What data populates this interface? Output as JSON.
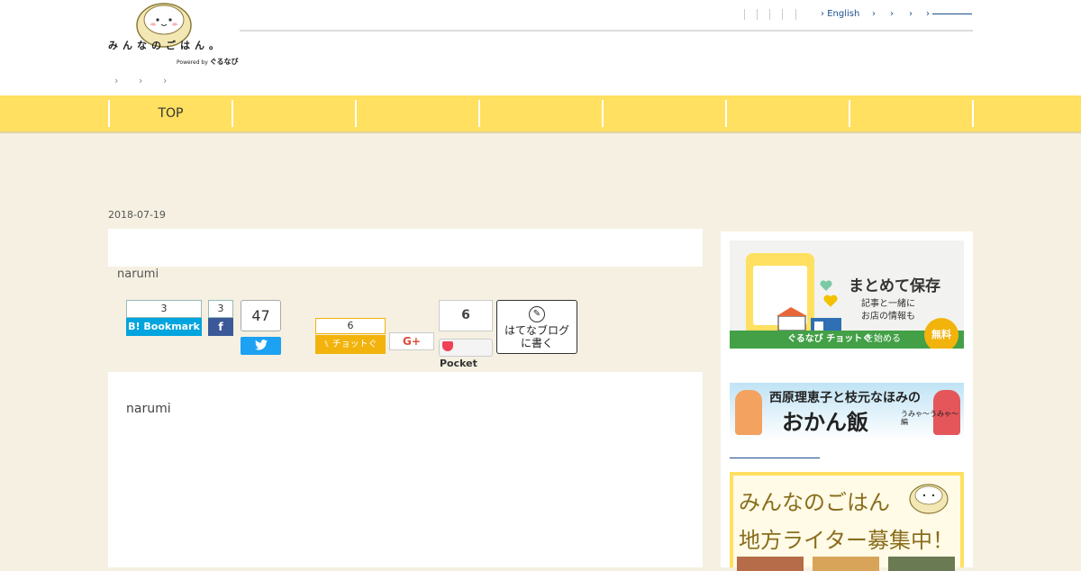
{
  "header": {
    "brand": "みんなのごはん。",
    "powered_prefix": "Powered by",
    "powered_brand": "ぐるなび",
    "top_links": [
      {
        "label": "English"
      },
      {
        "label": ""
      },
      {
        "label": ""
      },
      {
        "label": ""
      },
      {
        "label": ""
      }
    ],
    "link_arrow": "›",
    "crumb_arrow": "›"
  },
  "nav": {
    "items": [
      {
        "label": "TOP"
      },
      {
        "label": ""
      },
      {
        "label": ""
      },
      {
        "label": ""
      },
      {
        "label": ""
      },
      {
        "label": ""
      },
      {
        "label": ""
      }
    ]
  },
  "article": {
    "date": "2018-07-19",
    "title": "",
    "author": "narumi",
    "body_author": "narumi"
  },
  "share": {
    "hatena_count": "3",
    "hatena_label": "Bookmark",
    "facebook_count": "3",
    "twitter_count": "47",
    "chotto_count": "6",
    "chotto_label": "チョットぐ",
    "gplus_label": "G+",
    "pocket_count": "6",
    "pocket_label": "Pocket",
    "hatena_blog_line1": "はてなブログ",
    "hatena_blog_line2": "に書く"
  },
  "sidebar": {
    "banner1": {
      "headline": "まとめて保存",
      "sub_line1": "記事と一緒に",
      "sub_line2": "お店の情報も",
      "badge": "無料",
      "strip_brand": "ぐるなび チョットぐ",
      "strip_suffix": "を始める",
      "colors": {
        "strip": "#43a047",
        "badge": "#f2b30c",
        "phone": "#ffe060"
      }
    },
    "banner2": {
      "line1": "西原理恵子と枝元なほみの",
      "line2": "おかん飯",
      "tag": "うみゃ～うみゃ～編"
    },
    "banner3": {
      "line1": "みんなのごはん",
      "line2": "地方ライター募集中！"
    }
  },
  "colors": {
    "background": "#f5f0e1",
    "nav": "#ffe060",
    "link": "#1b4e8d",
    "hatena": "#00a4de",
    "facebook": "#3b5998",
    "twitter": "#1da1f2",
    "pocket": "#ef4056"
  }
}
